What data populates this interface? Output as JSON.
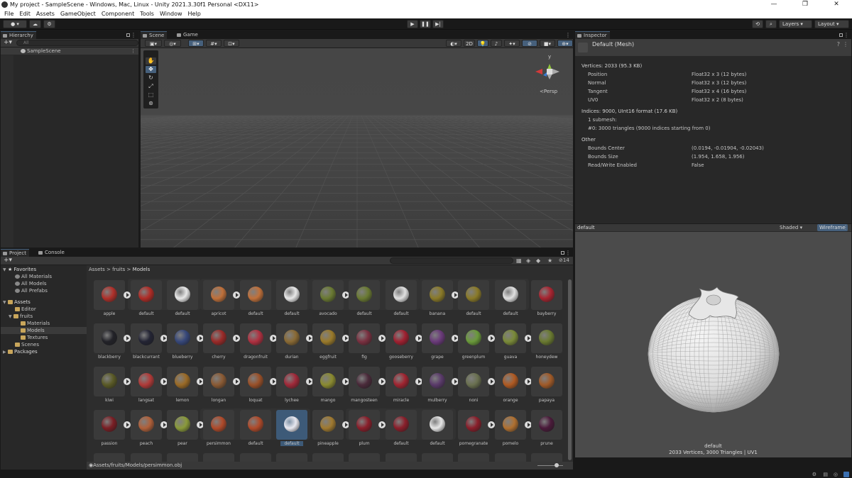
{
  "window": {
    "title": "My project - SampleScene - Windows, Mac, Linux - Unity 2021.3.30f1 Personal <DX11>",
    "controls": [
      "—",
      "❐",
      "✕"
    ]
  },
  "menu": [
    "File",
    "Edit",
    "Assets",
    "GameObject",
    "Component",
    "Tools",
    "Window",
    "Help"
  ],
  "toolbar": {
    "layers": "Layers",
    "layout": "Layout"
  },
  "hierarchy": {
    "tab": "Hierarchy",
    "search_placeholder": "All",
    "scene": "SampleScene"
  },
  "scene": {
    "tabs": [
      "Scene",
      "Game"
    ],
    "mode_2d": "2D",
    "persp": "Persp",
    "gizmo_y": "y"
  },
  "inspector": {
    "tab": "Inspector",
    "object": "Default (Mesh)",
    "vertices_header": "Vertices: 2033 (95.3 KB)",
    "attributes": [
      {
        "name": "Position",
        "value": "Float32 x 3 (12 bytes)"
      },
      {
        "name": "Normal",
        "value": "Float32 x 3 (12 bytes)"
      },
      {
        "name": "Tangent",
        "value": "Float32 x 4 (16 bytes)"
      },
      {
        "name": "UV0",
        "value": "Float32 x 2 (8 bytes)"
      }
    ],
    "indices_header": "Indices: 9000, UInt16 format (17.6 KB)",
    "submesh": "1 submesh:",
    "submesh_detail": "#0: 3000 triangles (9000 indices starting from 0)",
    "other_header": "Other",
    "other": [
      {
        "name": "Bounds Center",
        "value": "(0.0194, -0.01904, -0.02043)"
      },
      {
        "name": "Bounds Size",
        "value": "(1.954, 1.658, 1.956)"
      },
      {
        "name": "Read/Write Enabled",
        "value": "False"
      }
    ],
    "preview": {
      "name": "default",
      "shading": "Shaded",
      "wireframe": "Wireframe",
      "caption_name": "default",
      "caption_info": "2033 Vertices, 3000 Triangles | UV1"
    }
  },
  "project": {
    "tabs": [
      "Project",
      "Console"
    ],
    "favorites": "Favorites",
    "favorite_items": [
      "All Materials",
      "All Models",
      "All Prefabs"
    ],
    "assets": "Assets",
    "tree": [
      "Editor",
      "fruits",
      "Materials",
      "Models",
      "Textures",
      "Scenes"
    ],
    "packages": "Packages",
    "breadcrumb": [
      "Assets",
      "fruits",
      "Models"
    ],
    "hidden_count": "14",
    "status_path": "Assets/fruits/Models/persimmon.obj",
    "rows": [
      [
        "apple",
        "default",
        "default",
        "apricot",
        "default",
        "default",
        "avocado",
        "default",
        "default",
        "banana",
        "default",
        "default",
        "bayberry"
      ],
      [
        "blackberry",
        "blackcurrant",
        "blueberry",
        "cherry",
        "dragonfruit",
        "durian",
        "eggfruit",
        "fig",
        "gooseberry",
        "grape",
        "greenplum",
        "guava",
        "honeydew"
      ],
      [
        "kiwi",
        "langsat",
        "lemon",
        "longan",
        "loquat",
        "lychee",
        "mango",
        "mangosteen",
        "miracle",
        "mulberry",
        "noni",
        "orange",
        "papaya"
      ],
      [
        "passion",
        "peach",
        "pear",
        "persimmon",
        "default",
        "default",
        "pineapple",
        "plum",
        "default",
        "default",
        "pomegranate",
        "pomelo",
        "prune"
      ]
    ],
    "colors": [
      [
        "#b0302a",
        "#b02c26",
        "#e8e8e8",
        "#c0703a",
        "#c0703a",
        "#e8e8e8",
        "#6a7a32",
        "#6a7a32",
        "#e0e0e0",
        "#8a7a28",
        "#8a7a28",
        "#e0e0e0",
        "#a82430"
      ],
      [
        "#222228",
        "#232434",
        "#36477a",
        "#9a2a28",
        "#b03040",
        "#8a6a34",
        "#9a7a2a",
        "#7a3040",
        "#a02030",
        "#6a3a7a",
        "#6a9a3a",
        "#7a8a38",
        "#6a7a30"
      ],
      [
        "#5a5a26",
        "#b03a38",
        "#9a6a26",
        "#8a5a34",
        "#9a5028",
        "#a02838",
        "#8a8a30",
        "#4a2a3a",
        "#a02430",
        "#5a3a6a",
        "#6a7050",
        "#b05a22",
        "#a05a28"
      ],
      [
        "#7a1e24",
        "#b0603a",
        "#8a9a3a",
        "#b04a2a",
        "#b04a2a",
        "#e8e8f0",
        "#a07a30",
        "#8a1e2a",
        "#8a1e2a",
        "#e6e6e6",
        "#8a1e2a",
        "#b07030",
        "#4a1a3a"
      ]
    ]
  }
}
